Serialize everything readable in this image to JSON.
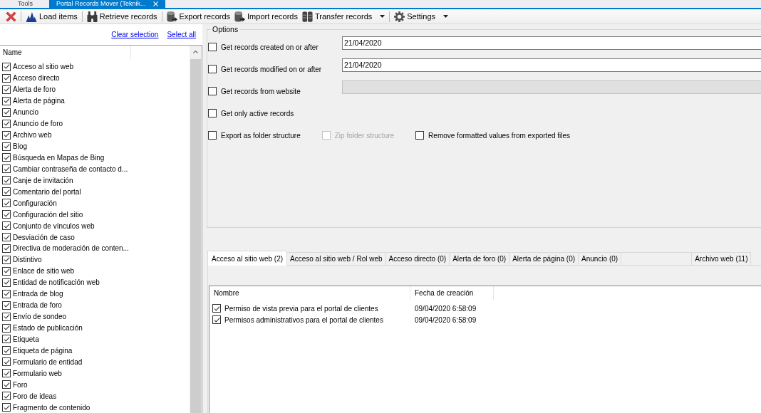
{
  "document_tabs": [
    {
      "label": "Tools",
      "selected": false,
      "closable": false
    },
    {
      "label": "Portal Records Mover (Teknik...",
      "selected": true,
      "closable": true
    }
  ],
  "toolbar": {
    "items": [
      {
        "kind": "icon-button"
      },
      {
        "kind": "separator"
      },
      {
        "kind": "button",
        "label": "Load items",
        "dropdown": false
      },
      {
        "kind": "separator"
      },
      {
        "kind": "button",
        "label": "Retrieve records",
        "dropdown": false
      },
      {
        "kind": "separator"
      },
      {
        "kind": "button",
        "label": "Export records",
        "dropdown": false
      },
      {
        "kind": "button",
        "label": "Import records",
        "dropdown": false
      },
      {
        "kind": "button",
        "label": "Transfer records",
        "dropdown": true
      },
      {
        "kind": "separator"
      },
      {
        "kind": "button",
        "label": "Settings",
        "dropdown": true
      }
    ]
  },
  "selection_links": [
    "Clear selection",
    "Select all"
  ],
  "entity_list": {
    "column": "Name",
    "items": [
      {
        "label": "Acceso al sitio web",
        "checked": true
      },
      {
        "label": "Acceso directo",
        "checked": true
      },
      {
        "label": "Alerta de foro",
        "checked": true
      },
      {
        "label": "Alerta de página",
        "checked": true
      },
      {
        "label": "Anuncio",
        "checked": true
      },
      {
        "label": "Anuncio de foro",
        "checked": true
      },
      {
        "label": "Archivo web",
        "checked": true
      },
      {
        "label": "Blog",
        "checked": true
      },
      {
        "label": "Búsqueda en Mapas de Bing",
        "checked": true
      },
      {
        "label": "Cambiar contraseña de contacto d...",
        "checked": true
      },
      {
        "label": "Canje de invitación",
        "checked": true
      },
      {
        "label": "Comentario del portal",
        "checked": true
      },
      {
        "label": "Configuración",
        "checked": true
      },
      {
        "label": "Configuración del sitio",
        "checked": true
      },
      {
        "label": "Conjunto de vínculos web",
        "checked": true
      },
      {
        "label": "Desviación de caso",
        "checked": true
      },
      {
        "label": "Directiva de moderación de conten...",
        "checked": true
      },
      {
        "label": "Distintivo",
        "checked": true
      },
      {
        "label": "Enlace de sitio web",
        "checked": true
      },
      {
        "label": "Entidad de notificación web",
        "checked": true
      },
      {
        "label": "Entrada de blog",
        "checked": true
      },
      {
        "label": "Entrada de foro",
        "checked": true
      },
      {
        "label": "Envío de sondeo",
        "checked": true
      },
      {
        "label": "Estado de publicación",
        "checked": true
      },
      {
        "label": "Etiqueta",
        "checked": true
      },
      {
        "label": "Etiqueta de página",
        "checked": true
      },
      {
        "label": "Formulario de entidad",
        "checked": true
      },
      {
        "label": "Formulario web",
        "checked": true
      },
      {
        "label": "Foro",
        "checked": true
      },
      {
        "label": "Foro de ideas",
        "checked": true
      },
      {
        "label": "Fragmento de contenido",
        "checked": true
      }
    ]
  },
  "options": {
    "title": "Options",
    "rows": [
      {
        "checkboxes": [
          {
            "label": "Get records created on or after",
            "checked": false,
            "disabled": false
          }
        ],
        "field": {
          "value": "21/04/2020",
          "disabled": false
        }
      },
      {
        "checkboxes": [
          {
            "label": "Get records modified on or after",
            "checked": false,
            "disabled": false
          }
        ],
        "field": {
          "value": "21/04/2020",
          "disabled": false
        }
      },
      {
        "checkboxes": [
          {
            "label": "Get records from website",
            "checked": false,
            "disabled": false
          }
        ],
        "field": {
          "disabled": true
        }
      },
      {
        "checkboxes": [
          {
            "label": "Get only active records",
            "checked": false,
            "disabled": false
          }
        ]
      },
      {
        "checkboxes": [
          {
            "label": "Export as folder structure",
            "checked": false,
            "disabled": false
          },
          {
            "label": "Zip folder structure",
            "checked": false,
            "disabled": true
          },
          {
            "label": "Remove formatted values from exported files",
            "checked": false,
            "disabled": false
          }
        ]
      }
    ]
  },
  "result_tabs": [
    {
      "label": "Acceso al sitio web (2)",
      "selected": true
    },
    {
      "label": "Acceso al sitio web / Rol web",
      "selected": false
    },
    {
      "label": "Acceso directo (0)",
      "selected": false
    },
    {
      "label": "Alerta de foro (0)",
      "selected": false
    },
    {
      "label": "Alerta de página (0)",
      "selected": false
    },
    {
      "label": "Anuncio (0)",
      "selected": false
    },
    {
      "selected": false
    },
    {
      "label": "Archivo web (11)",
      "selected": false
    }
  ],
  "records": {
    "columns": [
      "Nombre",
      "Fecha de creación"
    ],
    "rows": [
      {
        "checked": true,
        "name": "Permiso de vista previa para el portal de clientes",
        "created": "09/04/2020 6:58:09"
      },
      {
        "checked": true,
        "name": "Permisos administrativos para el portal de clientes",
        "created": "09/04/2020 6:58:09"
      }
    ]
  }
}
